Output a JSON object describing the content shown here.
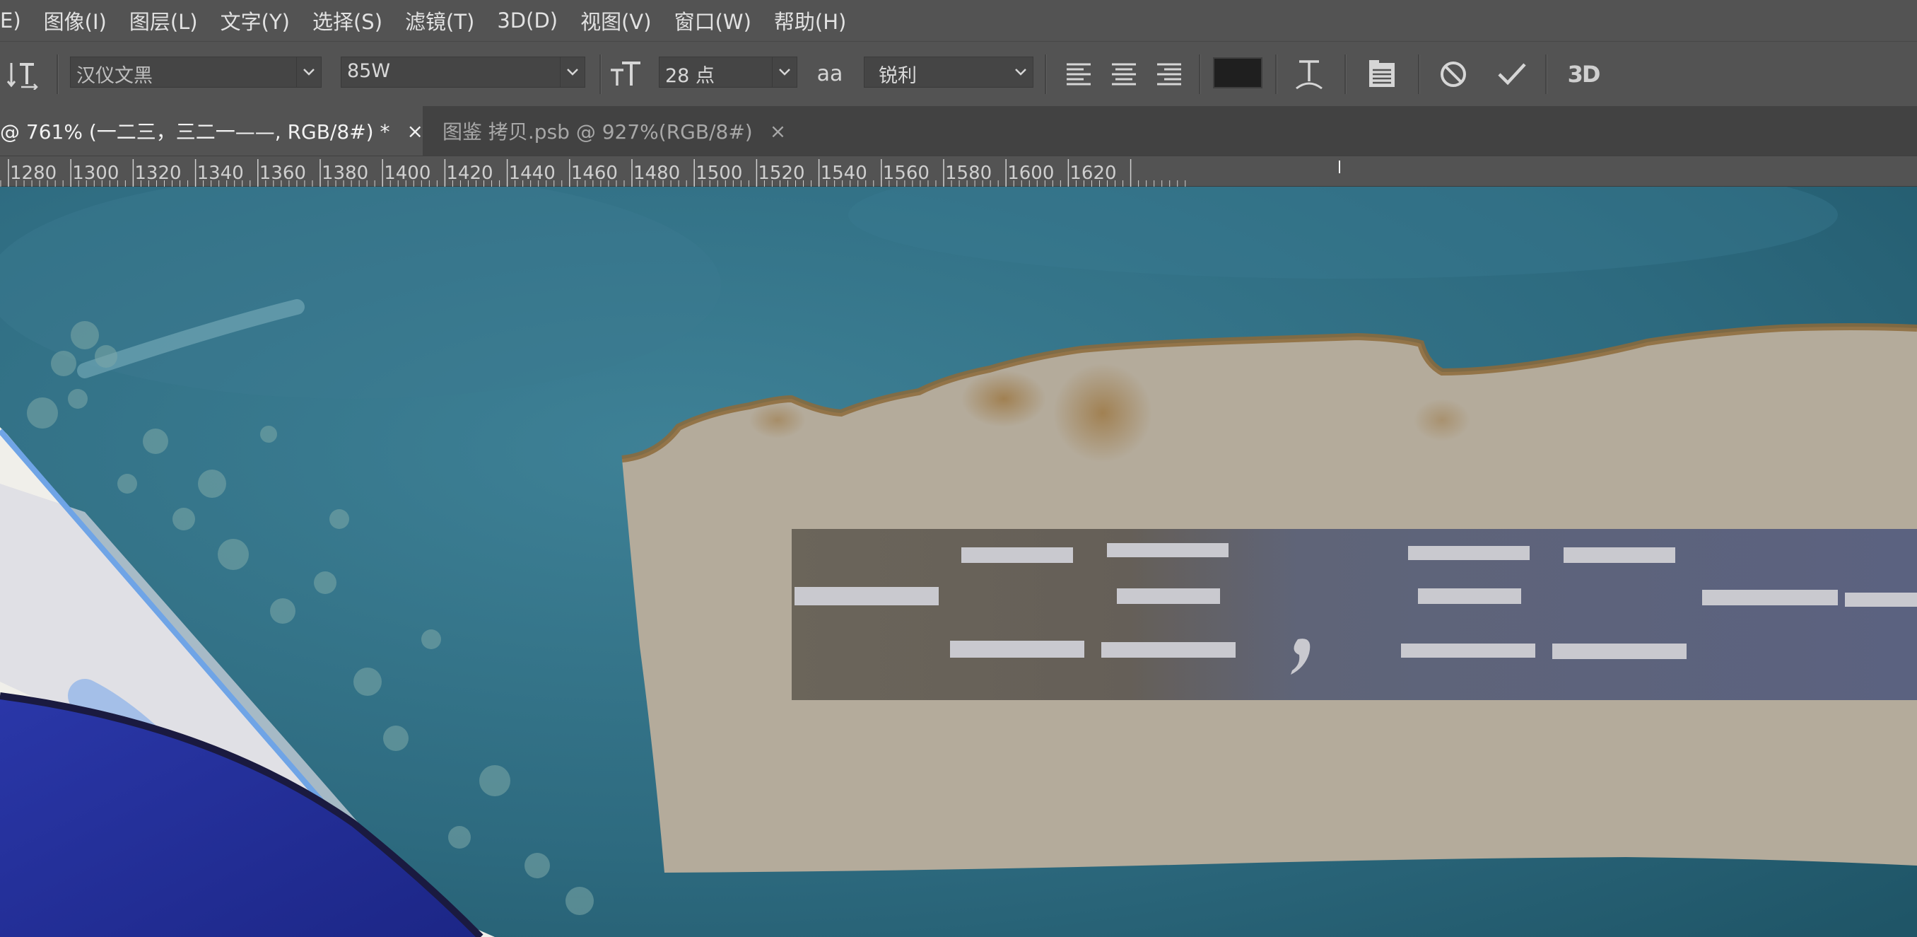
{
  "menu": {
    "items": [
      "E)",
      "图像(I)",
      "图层(L)",
      "文字(Y)",
      "选择(S)",
      "滤镜(T)",
      "3D(D)",
      "视图(V)",
      "窗口(W)",
      "帮助(H)"
    ]
  },
  "options": {
    "tool_icon": "vertical-type-icon",
    "font_family": "汉仪文黑",
    "font_style": "85W",
    "size_icon": "font-size-icon",
    "font_size": "28 点",
    "aa_icon": "aa",
    "antialias": "锐利",
    "align_icons": [
      "align-left-icon",
      "align-center-icon",
      "align-right-icon"
    ],
    "text_color": "#1f1f1f",
    "warp_icon": "warp-text-icon",
    "panel_icon": "character-panel-icon",
    "cancel_icon": "cancel-icon",
    "commit_icon": "commit-check-icon",
    "threed_label": "3D"
  },
  "tabs": [
    {
      "label": "@ 761% (一二三，三二一——, RGB/8#) *",
      "close": "×"
    },
    {
      "label": "图鉴 拷贝.psb @ 927%(RGB/8#)",
      "close": "×"
    }
  ],
  "ruler": {
    "labels": [
      "1280",
      "1300",
      "1320",
      "1340",
      "1360",
      "1380",
      "1400",
      "1420",
      "1440",
      "1460",
      "1480",
      "1500",
      "1520",
      "1540",
      "1560",
      "1580",
      "1600",
      "1620"
    ]
  },
  "colors": {
    "accent_bg": "#535353",
    "water": "#2d6b80",
    "paper": "#b3aa9a",
    "text_box": "#5e6479"
  }
}
